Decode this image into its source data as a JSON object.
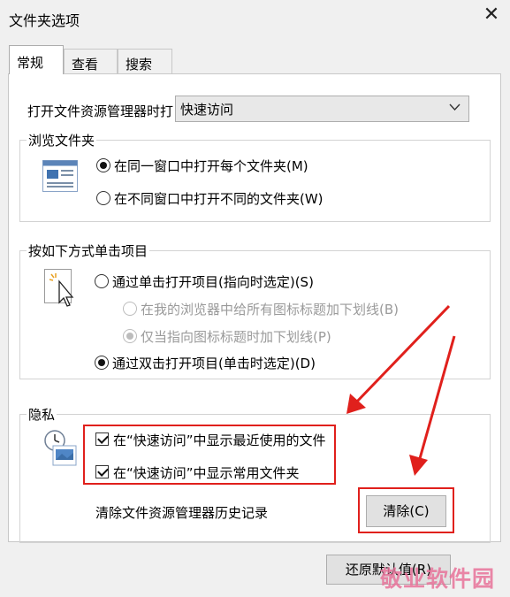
{
  "window": {
    "title": "文件夹选项",
    "close_glyph": "✕"
  },
  "tabs": [
    {
      "label": "常规",
      "active": true
    },
    {
      "label": "查看",
      "active": false
    },
    {
      "label": "搜索",
      "active": false
    }
  ],
  "open_explorer": {
    "label": "打开文件资源管理器时打",
    "value": "快速访问"
  },
  "browse_group": {
    "title": "浏览文件夹",
    "options": [
      {
        "label": "在同一窗口中打开每个文件夹(M)",
        "checked": true
      },
      {
        "label": "在不同窗口中打开不同的文件夹(W)",
        "checked": false
      }
    ]
  },
  "click_group": {
    "title": "按如下方式单击项目",
    "single_click": {
      "label": "通过单击打开项目(指向时选定)(S)",
      "checked": false
    },
    "underline_all": {
      "label": "在我的浏览器中给所有图标标题加下划线(B)",
      "checked": false,
      "disabled": true
    },
    "underline_point": {
      "label": "仅当指向图标标题时加下划线(P)",
      "checked": true,
      "disabled": true
    },
    "double_click": {
      "label": "通过双击打开项目(单击时选定)(D)",
      "checked": true
    }
  },
  "privacy_group": {
    "title": "隐私",
    "recent_files": {
      "label": "在“快速访问”中显示最近使用的文件",
      "checked": true
    },
    "frequent_folders": {
      "label": "在“快速访问”中显示常用文件夹",
      "checked": true
    },
    "clear_history_label": "清除文件资源管理器历史记录",
    "clear_button": "清除(C)"
  },
  "restore_defaults_button": "还原默认值(R)",
  "watermark": "敬业软件园",
  "colors": {
    "annotation_red": "#e0201c",
    "watermark": "#e8739a"
  }
}
